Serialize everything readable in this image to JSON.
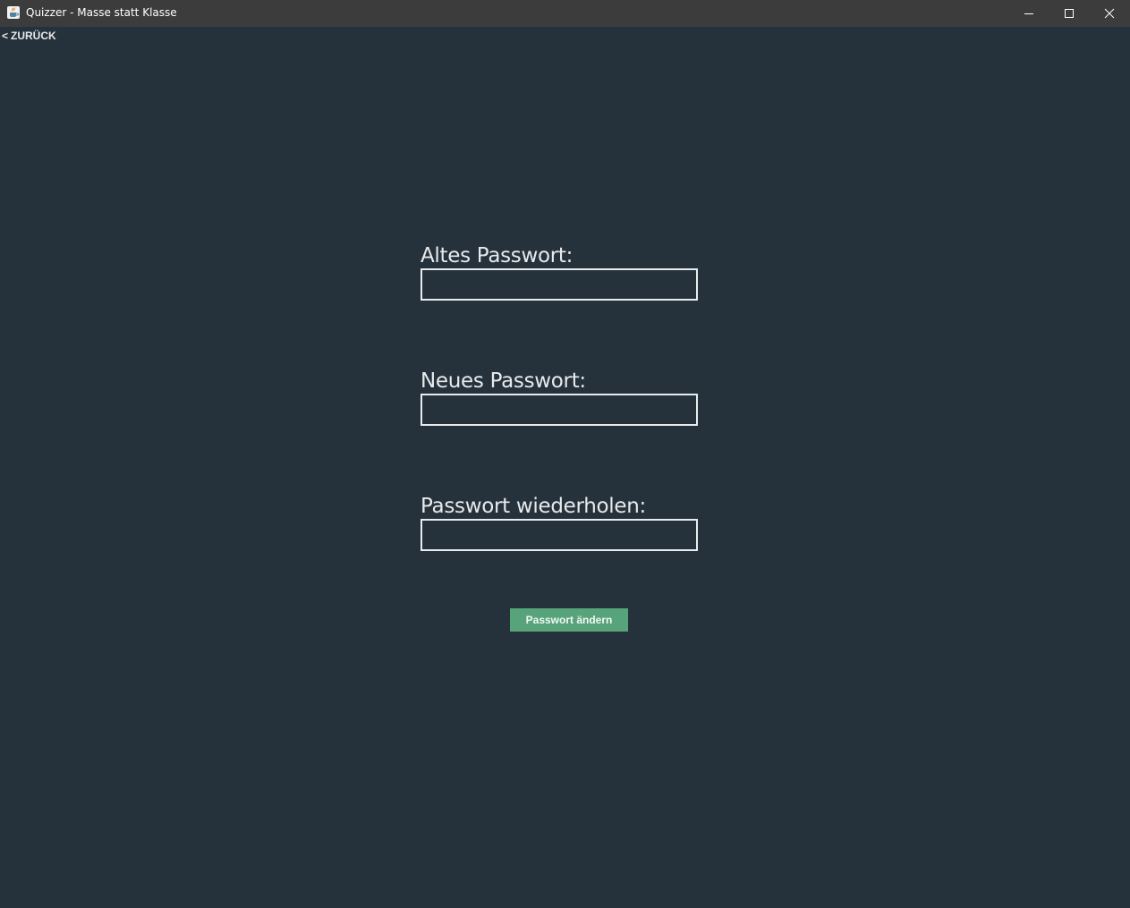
{
  "window": {
    "title": "Quizzer - Masse statt Klasse",
    "icon": "java-cup-icon",
    "controls": [
      "minimize-icon",
      "maximize-icon",
      "close-icon"
    ]
  },
  "nav": {
    "back_arrow": "<",
    "back_label": "ZURÜCK"
  },
  "form": {
    "old_password_label": "Altes Passwort:",
    "old_password_value": "",
    "new_password_label": "Neues Passwort:",
    "new_password_value": "",
    "repeat_password_label": "Passwort wiederholen:",
    "repeat_password_value": "",
    "submit_label": "Passwort ändern"
  },
  "colors": {
    "background": "#25323c",
    "titlebar": "#3c3c3c",
    "accent": "#57a47b",
    "text": "#e8eaec"
  }
}
